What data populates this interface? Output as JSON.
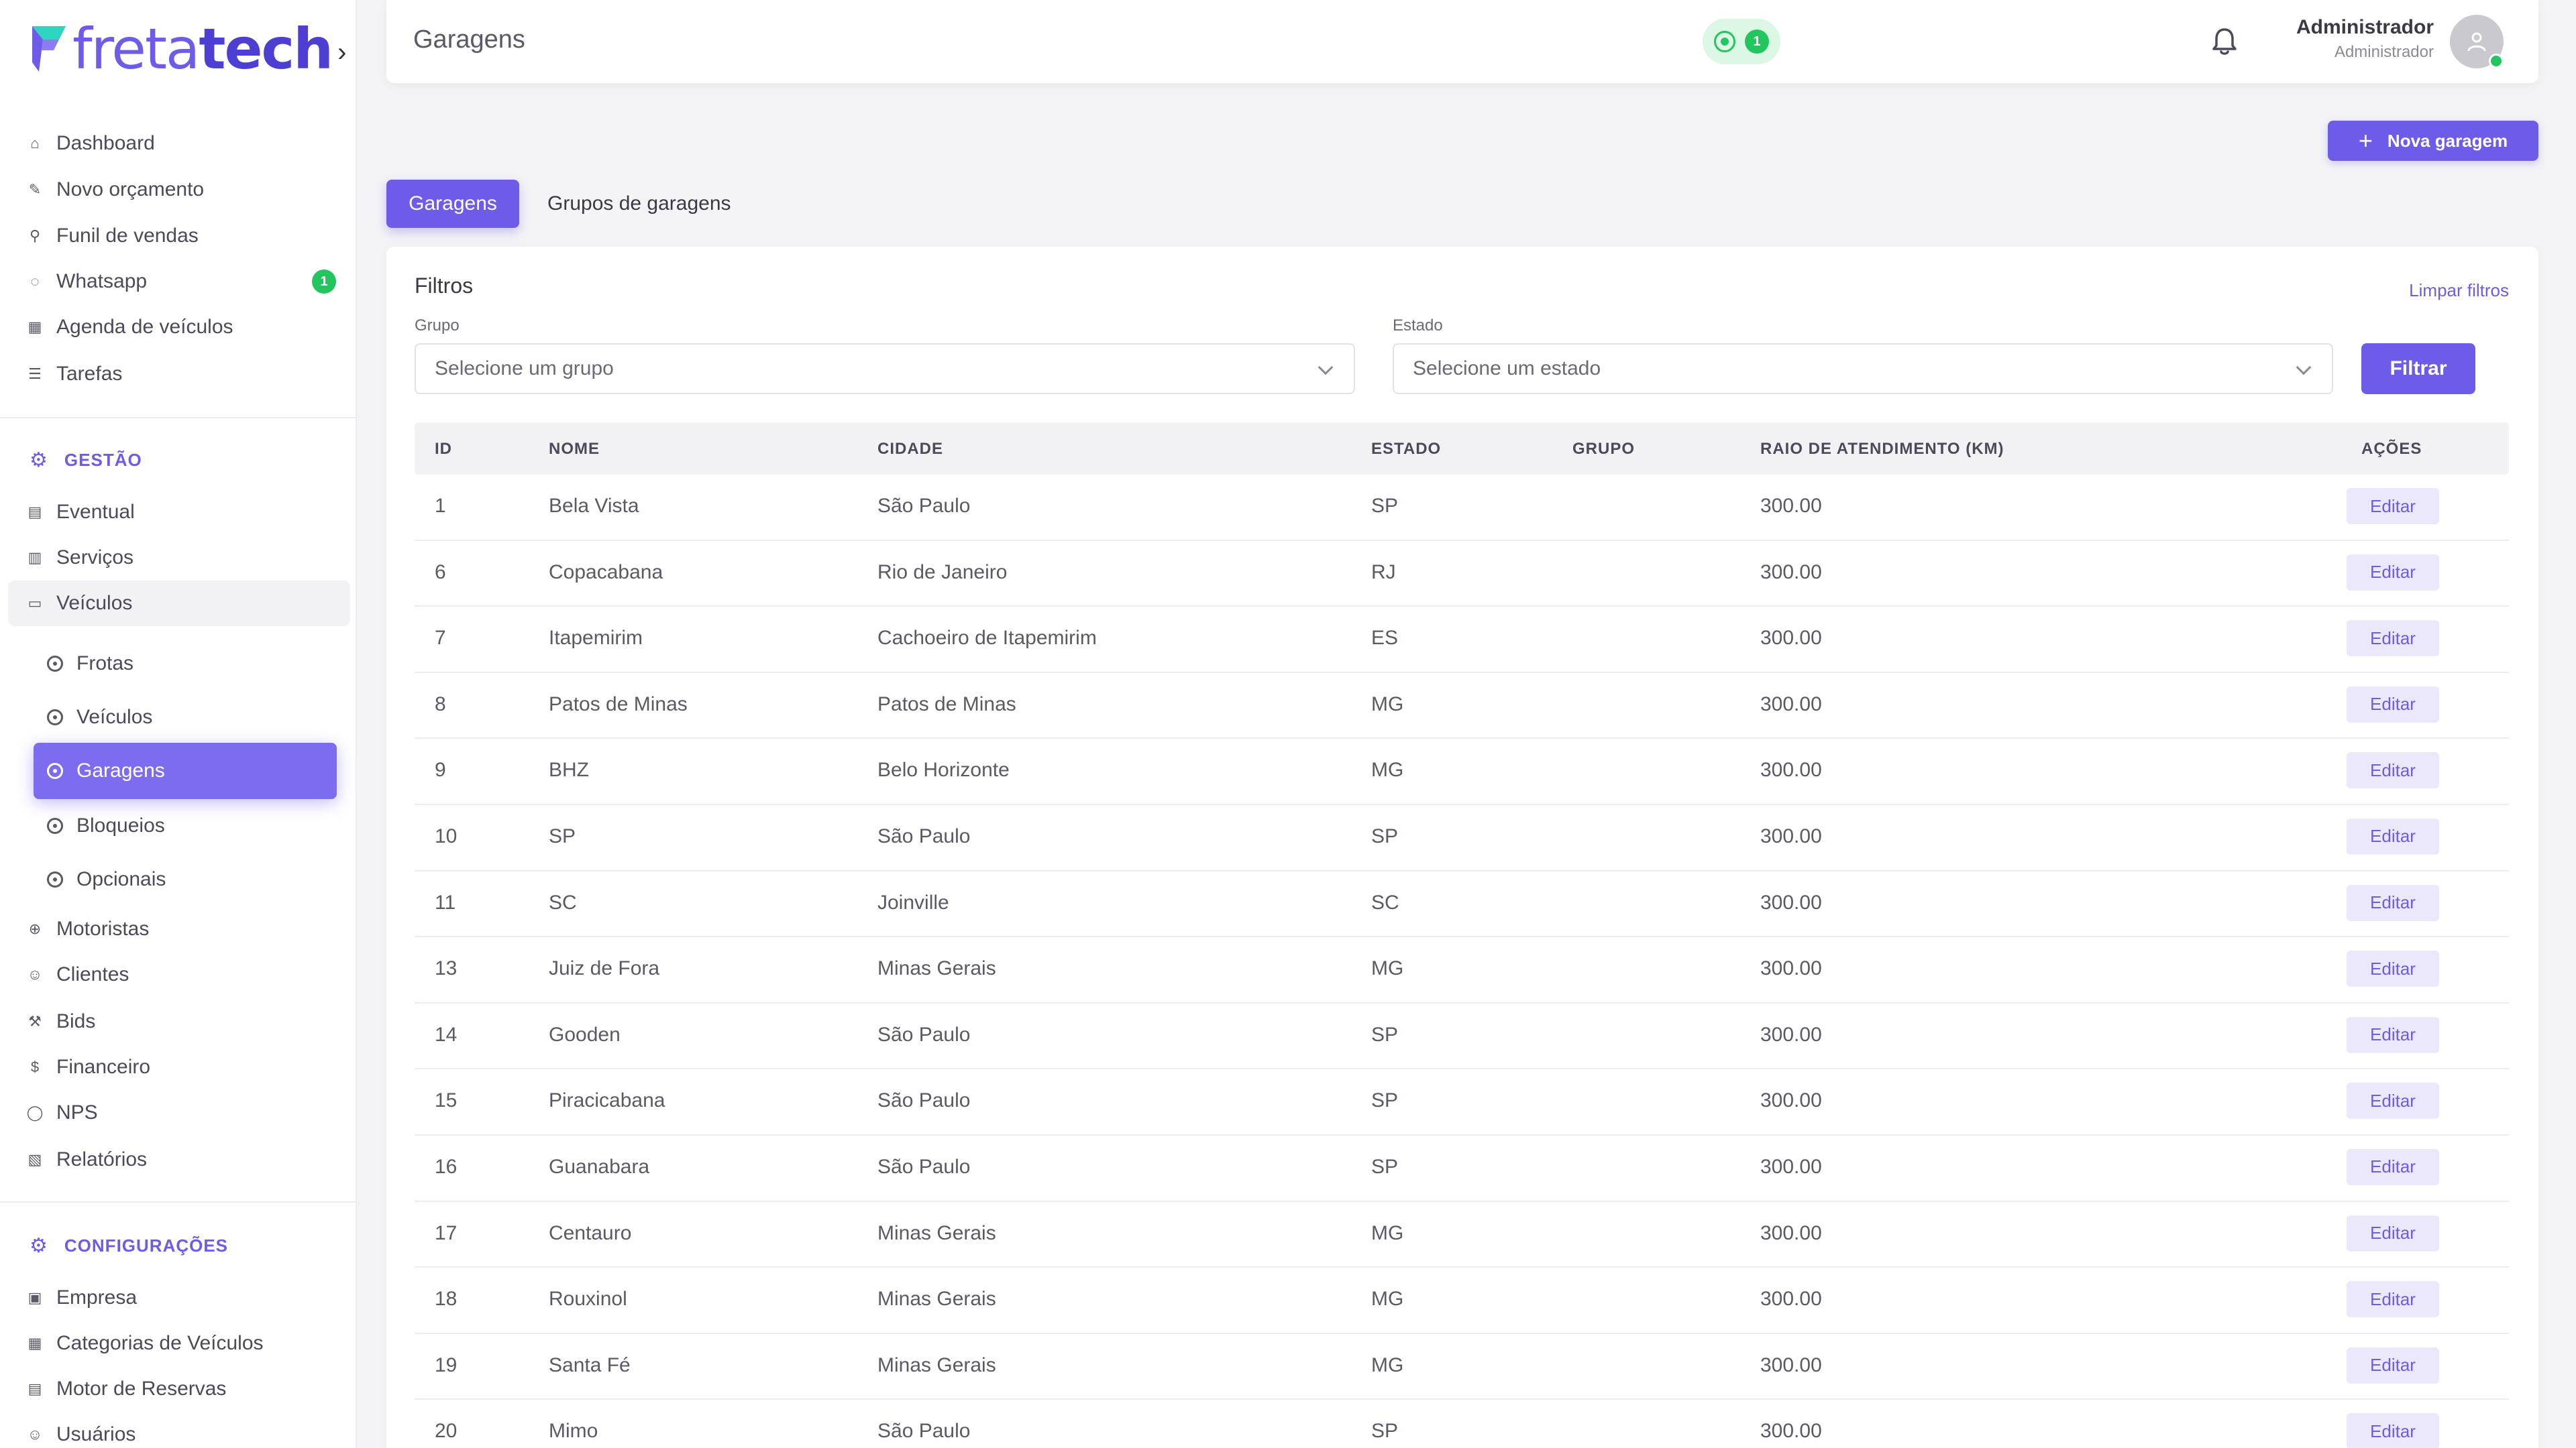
{
  "brand": {
    "logo_light": "freta",
    "logo_bold": "tech"
  },
  "header": {
    "title": "Garagens",
    "whatsapp_count": "1",
    "user_name": "Administrador",
    "user_role": "Administrador"
  },
  "sidebar": {
    "main": [
      {
        "label": "Dashboard",
        "icon": "home-icon"
      },
      {
        "label": "Novo orçamento",
        "icon": "edit-icon"
      },
      {
        "label": "Funil de vendas",
        "icon": "funnel-icon"
      },
      {
        "label": "Whatsapp",
        "icon": "whatsapp-icon",
        "badge": "1"
      },
      {
        "label": "Agenda de veículos",
        "icon": "calendar-icon"
      },
      {
        "label": "Tarefas",
        "icon": "tasks-icon"
      }
    ],
    "section_gestao": "GESTÃO",
    "gestao": [
      {
        "label": "Eventual",
        "icon": "document-icon"
      },
      {
        "label": "Serviços",
        "icon": "clipboard-icon"
      },
      {
        "label": "Veículos",
        "icon": "bus-icon"
      }
    ],
    "veiculos_sub": [
      {
        "label": "Frotas"
      },
      {
        "label": "Veículos"
      },
      {
        "label": "Garagens",
        "active": true
      },
      {
        "label": "Bloqueios"
      },
      {
        "label": "Opcionais"
      }
    ],
    "gestao_more": [
      {
        "label": "Motoristas",
        "icon": "steering-wheel-icon"
      },
      {
        "label": "Clientes",
        "icon": "users-icon"
      },
      {
        "label": "Bids",
        "icon": "gavel-icon"
      },
      {
        "label": "Financeiro",
        "icon": "dollar-icon"
      },
      {
        "label": "NPS",
        "icon": "chat-icon"
      },
      {
        "label": "Relatórios",
        "icon": "report-icon"
      }
    ],
    "section_config": "CONFIGURAÇÕES",
    "config": [
      {
        "label": "Empresa",
        "icon": "building-icon"
      },
      {
        "label": "Categorias de Veículos",
        "icon": "grid-icon"
      },
      {
        "label": "Motor de Reservas",
        "icon": "table-icon"
      },
      {
        "label": "Usuários",
        "icon": "user-icon"
      }
    ]
  },
  "actions": {
    "new_garage": "Nova garagem"
  },
  "tabs": [
    {
      "label": "Garagens",
      "active": true
    },
    {
      "label": "Grupos de garagens"
    }
  ],
  "filters": {
    "title": "Filtros",
    "clear": "Limpar filtros",
    "group_label": "Grupo",
    "group_placeholder": "Selecione um grupo",
    "state_label": "Estado",
    "state_placeholder": "Selecione um estado",
    "submit": "Filtrar"
  },
  "table": {
    "columns": [
      "ID",
      "NOME",
      "CIDADE",
      "ESTADO",
      "GRUPO",
      "RAIO DE ATENDIMENTO (KM)",
      "AÇÕES"
    ],
    "edit_label": "Editar",
    "rows": [
      {
        "id": "1",
        "nome": "Bela Vista",
        "cidade": "São Paulo",
        "estado": "SP",
        "grupo": "",
        "raio": "300.00"
      },
      {
        "id": "6",
        "nome": "Copacabana",
        "cidade": "Rio de Janeiro",
        "estado": "RJ",
        "grupo": "",
        "raio": "300.00"
      },
      {
        "id": "7",
        "nome": "Itapemirim",
        "cidade": "Cachoeiro de Itapemirim",
        "estado": "ES",
        "grupo": "",
        "raio": "300.00"
      },
      {
        "id": "8",
        "nome": "Patos de Minas",
        "cidade": "Patos de Minas",
        "estado": "MG",
        "grupo": "",
        "raio": "300.00"
      },
      {
        "id": "9",
        "nome": "BHZ",
        "cidade": "Belo Horizonte",
        "estado": "MG",
        "grupo": "",
        "raio": "300.00"
      },
      {
        "id": "10",
        "nome": "SP",
        "cidade": "São Paulo",
        "estado": "SP",
        "grupo": "",
        "raio": "300.00"
      },
      {
        "id": "11",
        "nome": "SC",
        "cidade": "Joinville",
        "estado": "SC",
        "grupo": "",
        "raio": "300.00"
      },
      {
        "id": "13",
        "nome": "Juiz de Fora",
        "cidade": "Minas Gerais",
        "estado": "MG",
        "grupo": "",
        "raio": "300.00"
      },
      {
        "id": "14",
        "nome": "Gooden",
        "cidade": "São Paulo",
        "estado": "SP",
        "grupo": "",
        "raio": "300.00"
      },
      {
        "id": "15",
        "nome": "Piracicabana",
        "cidade": "São Paulo",
        "estado": "SP",
        "grupo": "",
        "raio": "300.00"
      },
      {
        "id": "16",
        "nome": "Guanabara",
        "cidade": "São Paulo",
        "estado": "SP",
        "grupo": "",
        "raio": "300.00"
      },
      {
        "id": "17",
        "nome": "Centauro",
        "cidade": "Minas Gerais",
        "estado": "MG",
        "grupo": "",
        "raio": "300.00"
      },
      {
        "id": "18",
        "nome": "Rouxinol",
        "cidade": "Minas Gerais",
        "estado": "MG",
        "grupo": "",
        "raio": "300.00"
      },
      {
        "id": "19",
        "nome": "Santa Fé",
        "cidade": "Minas Gerais",
        "estado": "MG",
        "grupo": "",
        "raio": "300.00"
      },
      {
        "id": "20",
        "nome": "Mimo",
        "cidade": "São Paulo",
        "estado": "SP",
        "grupo": "",
        "raio": "300.00"
      }
    ]
  },
  "colors": {
    "accent": "#6c5ce7",
    "success": "#22c55e"
  }
}
